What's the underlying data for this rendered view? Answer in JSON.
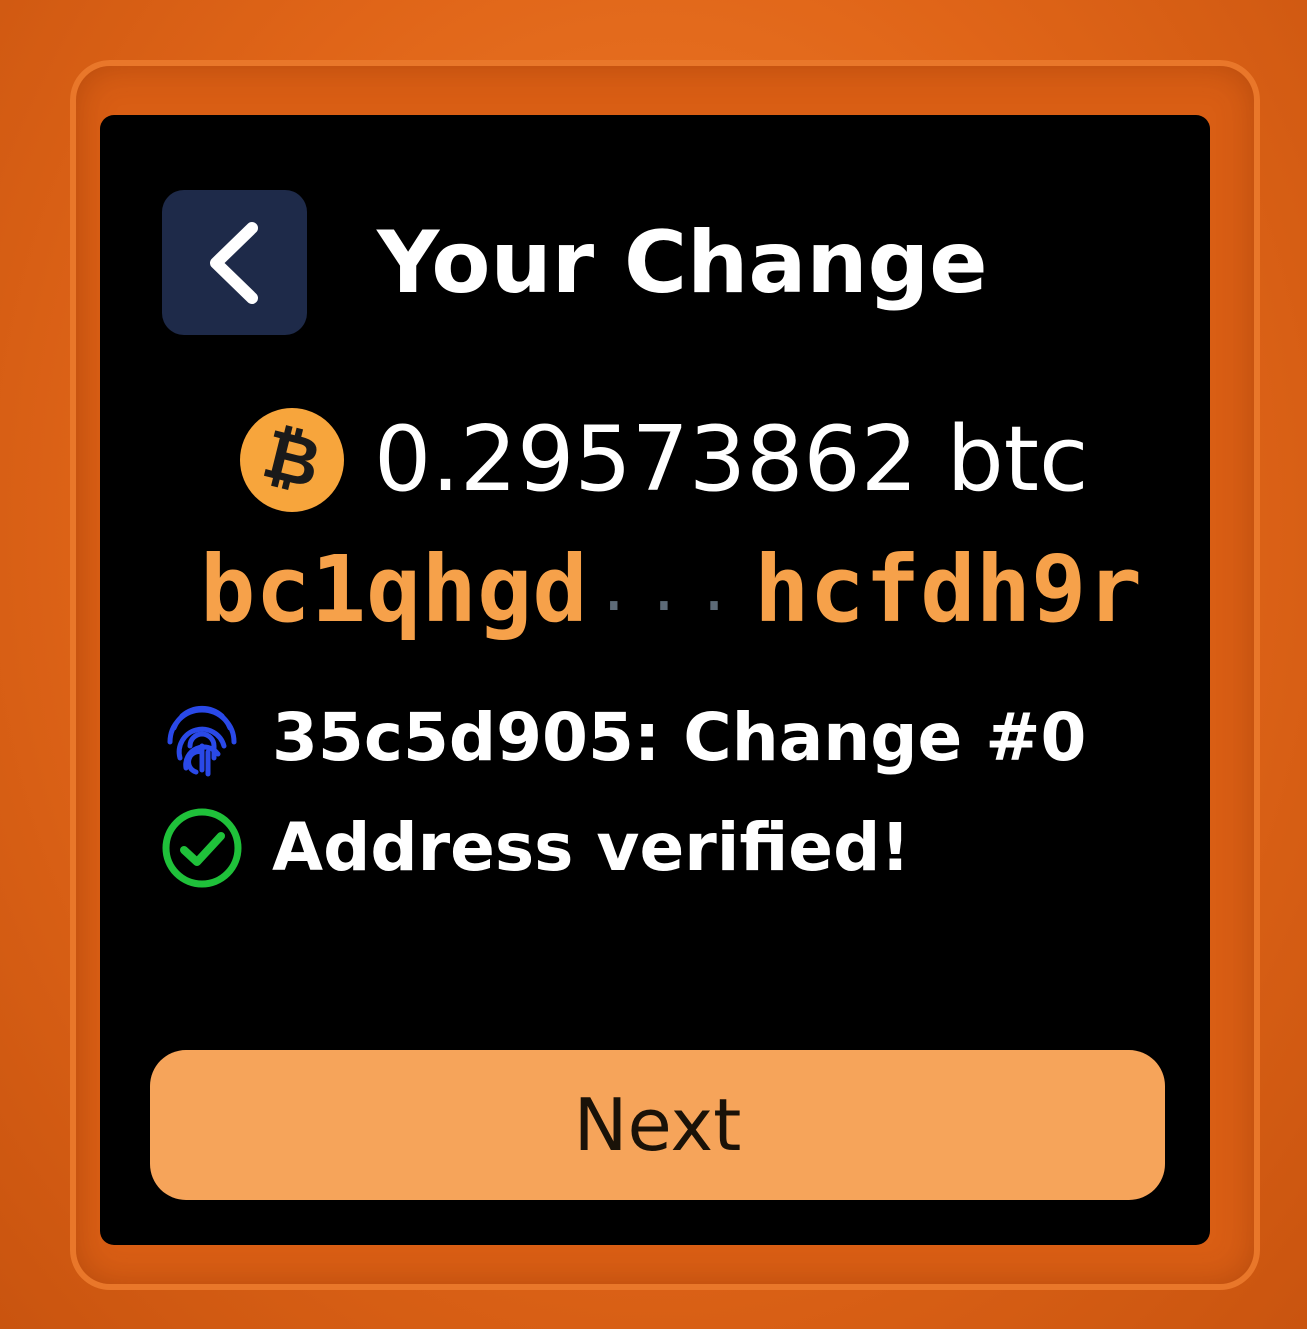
{
  "header": {
    "title": "Your Change",
    "back_icon": "chevron-left-icon"
  },
  "output": {
    "currency_icon": "bitcoin-icon",
    "amount": "0.29573862 btc",
    "address_start": "bc1qhgd",
    "address_separator": "...",
    "address_end": "hcfdh9r"
  },
  "details": {
    "wallet_icon": "fingerprint-icon",
    "wallet_label": "35c5d905: Change #0",
    "status_icon": "check-circle-icon",
    "status_label": "Address verified!"
  },
  "actions": {
    "next_label": "Next"
  },
  "colors": {
    "accent_orange": "#f6a45a",
    "back_button_bg": "#1e2a49",
    "fingerprint_blue": "#2a49e8",
    "verified_green": "#1fc13a"
  }
}
